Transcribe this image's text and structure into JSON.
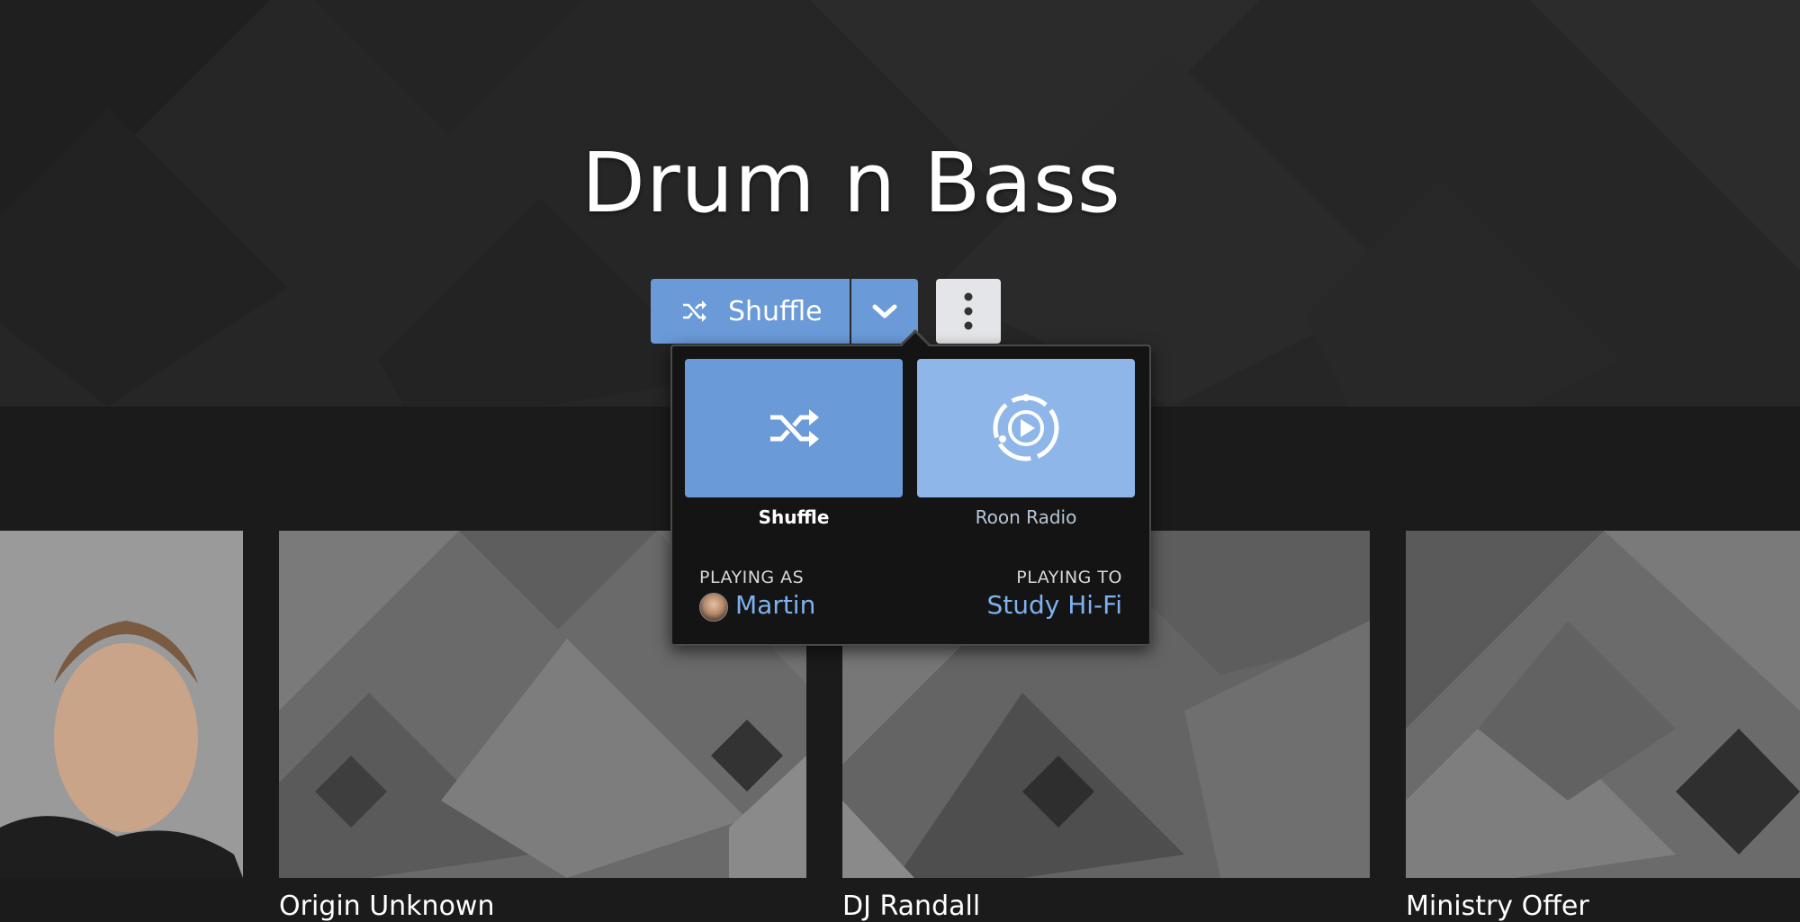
{
  "page": {
    "title": "Drum n Bass"
  },
  "actions": {
    "shuffle_label": "Shuffle",
    "dropdown_icon": "chevron-down-icon",
    "more_icon": "more-vertical-icon",
    "accent_color": "#6a9ad8"
  },
  "popup": {
    "options": [
      {
        "label": "Shuffle",
        "icon": "shuffle-icon",
        "selected": true
      },
      {
        "label": "Roon Radio",
        "icon": "radio-icon",
        "selected": false
      }
    ],
    "playing_as_label": "PLAYING AS",
    "playing_as_value": "Martin",
    "playing_to_label": "PLAYING TO",
    "playing_to_value": "Study Hi-Fi",
    "link_color": "#7fb1ee"
  },
  "artists": [
    {
      "name": ""
    },
    {
      "name": "Origin Unknown"
    },
    {
      "name": "DJ Randall"
    },
    {
      "name": "Ministry Offer"
    }
  ]
}
